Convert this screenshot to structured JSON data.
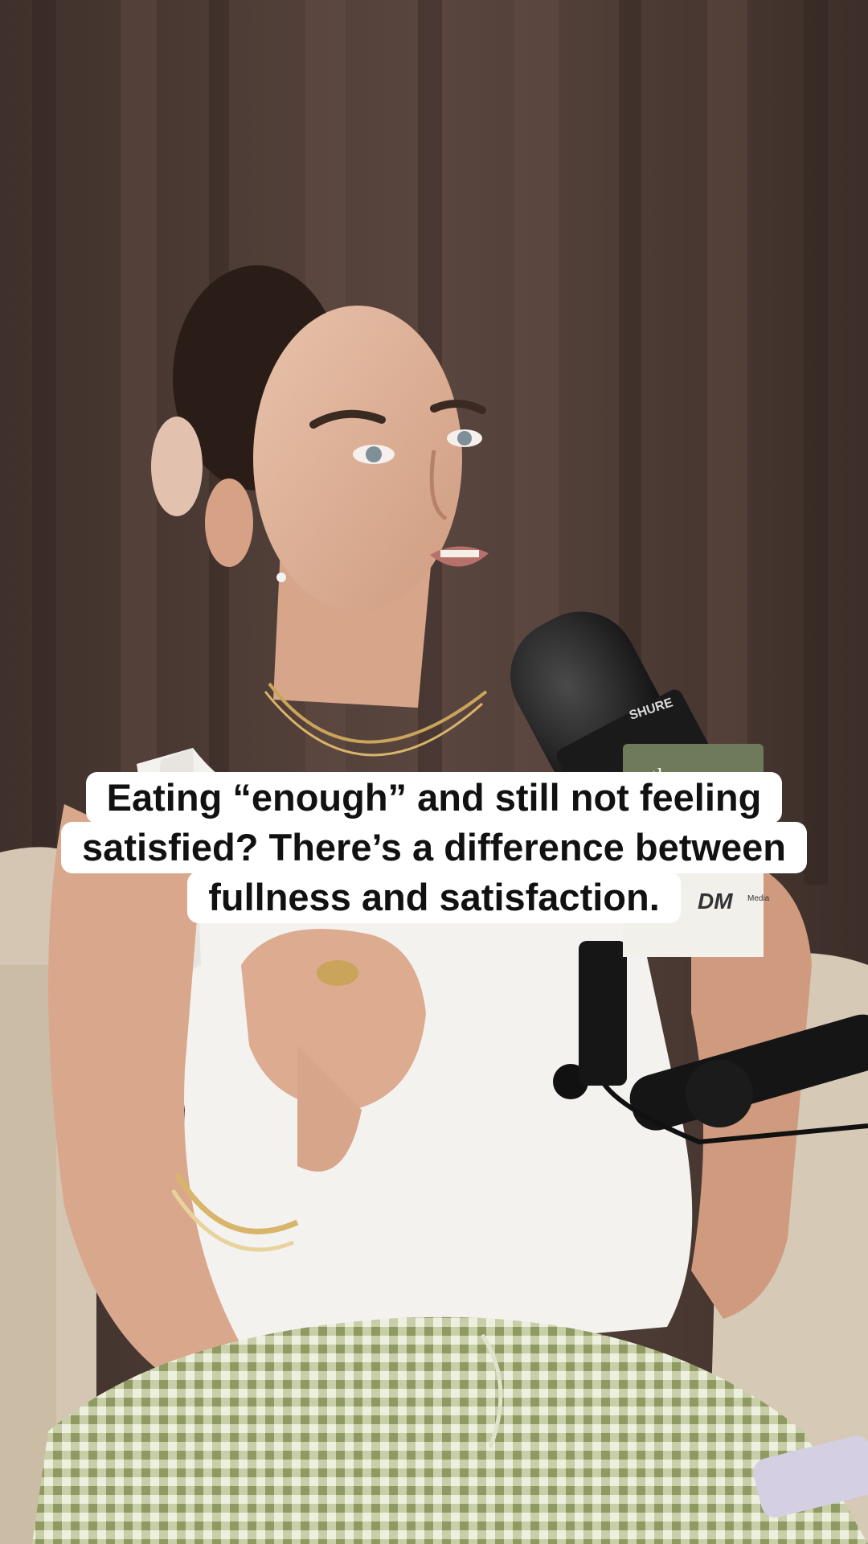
{
  "video_frame": {
    "subject": "woman-speaking-into-podcast-microphone",
    "background": "brown-curtain"
  },
  "caption": {
    "lines": [
      "Eating “enough” and still not feeling",
      "satisfied? There’s a difference between",
      "fullness and satisfaction."
    ]
  },
  "brand_card": {
    "top_text": "the",
    "logo_text": "DM",
    "small_text": "Media"
  },
  "mic_brand": "SHURE",
  "colors": {
    "curtain": "#4d3a34",
    "sofa": "#d6c8b4",
    "shirt": "#f4f2ef",
    "gingham": "#b7bf93",
    "caption_bg": "#ffffff",
    "caption_text": "#111111",
    "mic_card": "#6f7a5b"
  }
}
